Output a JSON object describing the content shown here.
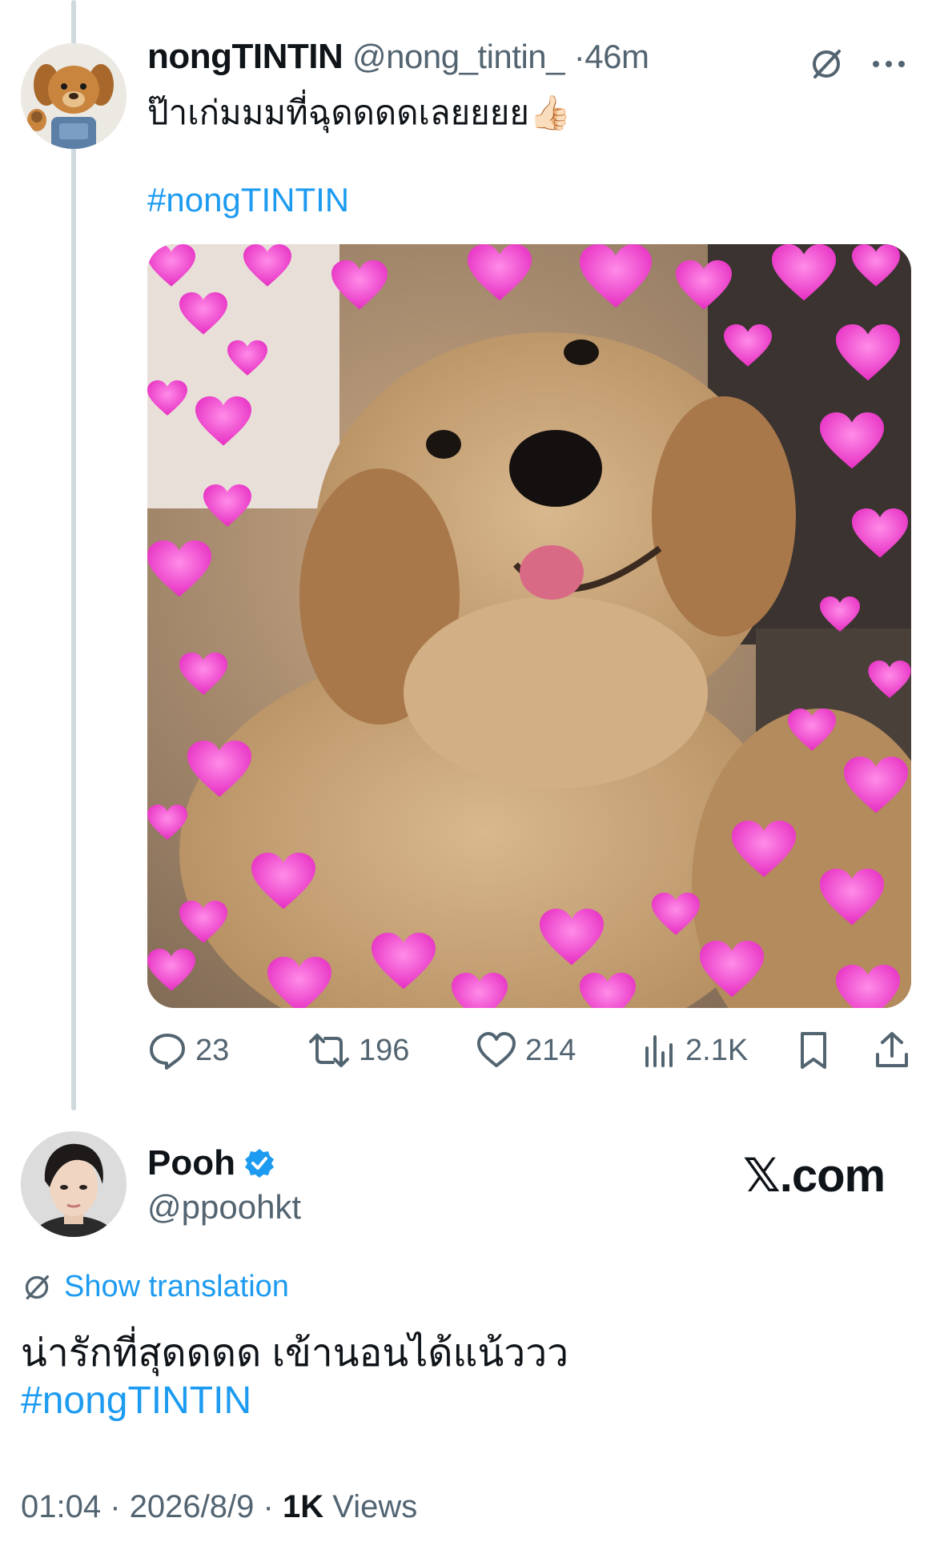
{
  "tweet1": {
    "display_name": "nongTINTIN",
    "handle": "@nong_tintin_",
    "separator": "·",
    "time_ago": "46m",
    "text": "ป๊าเก่มมมที่ฉุดดดดเลยยยย👍🏻",
    "hashtag": "#nongTINTIN",
    "media": {
      "subject": "golden retriever puppy with pink hearts"
    },
    "actions": {
      "replies": "23",
      "reposts": "196",
      "likes": "214",
      "views": "2.1K"
    },
    "icons": [
      "translate-icon",
      "more-icon",
      "reply-icon",
      "repost-icon",
      "like-icon",
      "views-icon",
      "bookmark-icon",
      "share-icon"
    ]
  },
  "tweet2": {
    "display_name": "Pooh",
    "verified": true,
    "handle": "@ppoohkt",
    "brand_logo": "𝕏",
    "brand_suffix": ".com",
    "show_translation": "Show translation",
    "text": "น่ารักที่สุดดดด เข้านอนได้แน้ววว",
    "hashtag": "#nongTINTIN",
    "time": "01:04",
    "separator": "·",
    "date": "2026/8/9",
    "separator2": "·",
    "views_count": "1K",
    "views_label": "Views"
  },
  "colors": {
    "accent": "#1d9bf0",
    "secondary_text": "#536471",
    "primary_text": "#0f1419",
    "thread_line": "#cfd9de"
  }
}
